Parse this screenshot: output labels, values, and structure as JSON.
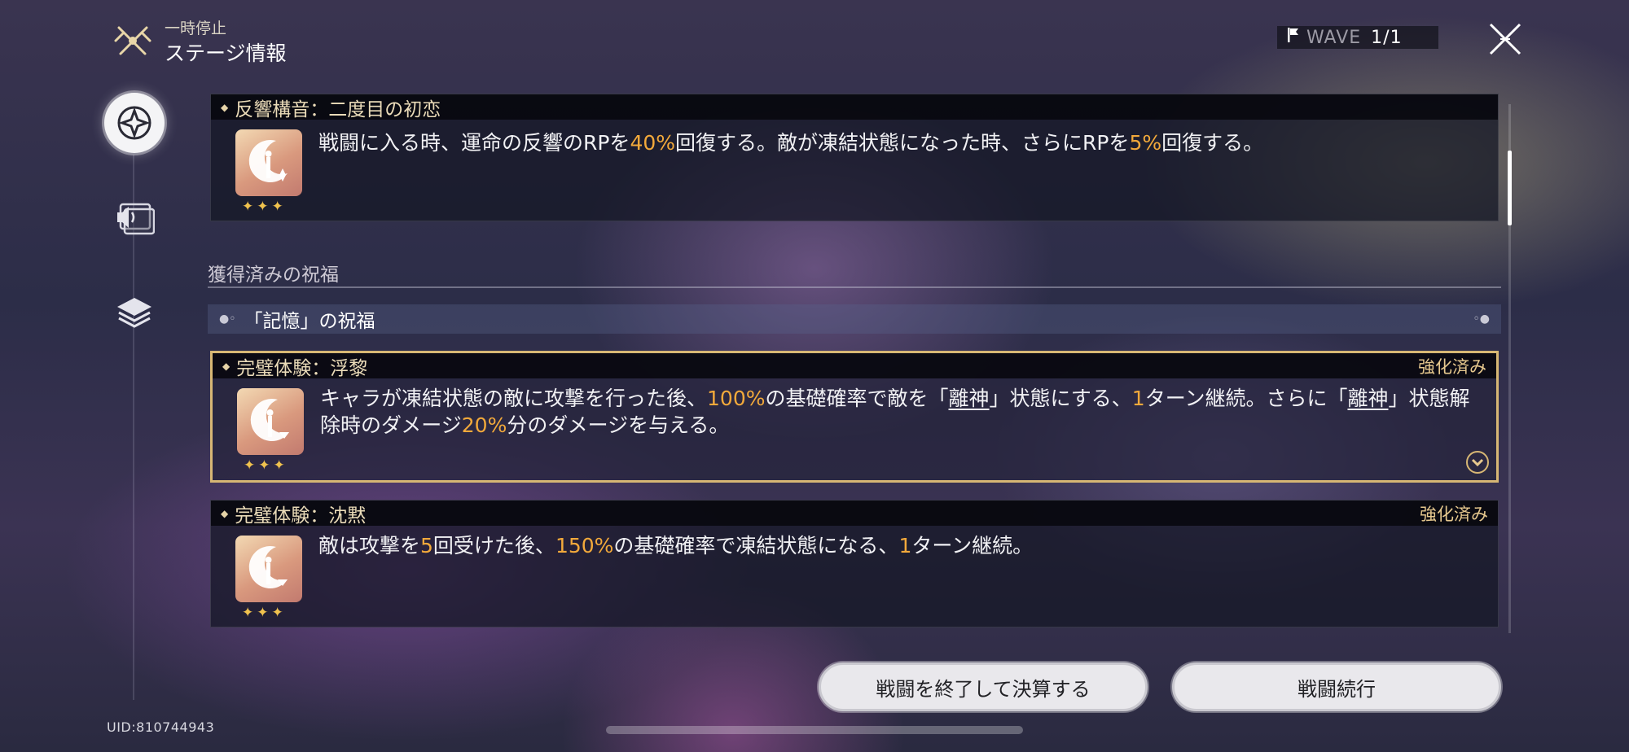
{
  "header": {
    "pause_label": "一時停止",
    "title": "ステージ情報",
    "wave_label": "WAVE",
    "wave_value": "1/1"
  },
  "sidebar": {
    "items": [
      {
        "name": "blessing",
        "icon": "compass-star-icon",
        "active": true
      },
      {
        "name": "audio",
        "icon": "speaker-cards-icon",
        "active": false
      },
      {
        "name": "layers",
        "icon": "layers-icon",
        "active": false
      }
    ]
  },
  "card1": {
    "title": "反響構音：二度目の初恋",
    "desc_parts": [
      "戦闘に入る時、運命の反響のRPを",
      "40%",
      "回復する。敵が凍結状態になった時、さらにRPを",
      "5%",
      "回復する。"
    ],
    "stars": "✦✦✦"
  },
  "section": {
    "title": "獲得済みの祝福",
    "group_label": "「記憶」の祝福"
  },
  "card2": {
    "title": "完璧体験：浮黎",
    "badge": "強化済み",
    "desc_parts": [
      "キャラが凍結状態の敵に攻撃を行った後、",
      "100%",
      "の基礎確率で敵を「",
      "離神",
      "」状態にする、",
      "1",
      "ターン継続。さらに「",
      "離神",
      "」状態解除時のダメージ",
      "20%",
      "分のダメージを与える。"
    ],
    "stars": "✦✦✦"
  },
  "card3": {
    "title": "完璧体験：沈黙",
    "badge": "強化済み",
    "desc_parts": [
      "敵は攻撃を",
      "5",
      "回受けた後、",
      "150%",
      "の基礎確率で凍結状態になる、",
      "1",
      "ターン継続。"
    ],
    "stars": "✦✦✦"
  },
  "buttons": {
    "end_battle": "戦闘を終了して決算する",
    "continue_battle": "戦闘続行"
  },
  "uid": "UID:810744943",
  "colors": {
    "highlight": "#f2a93b",
    "gold_border": "#d7b774",
    "badge": "#e6c88e"
  }
}
